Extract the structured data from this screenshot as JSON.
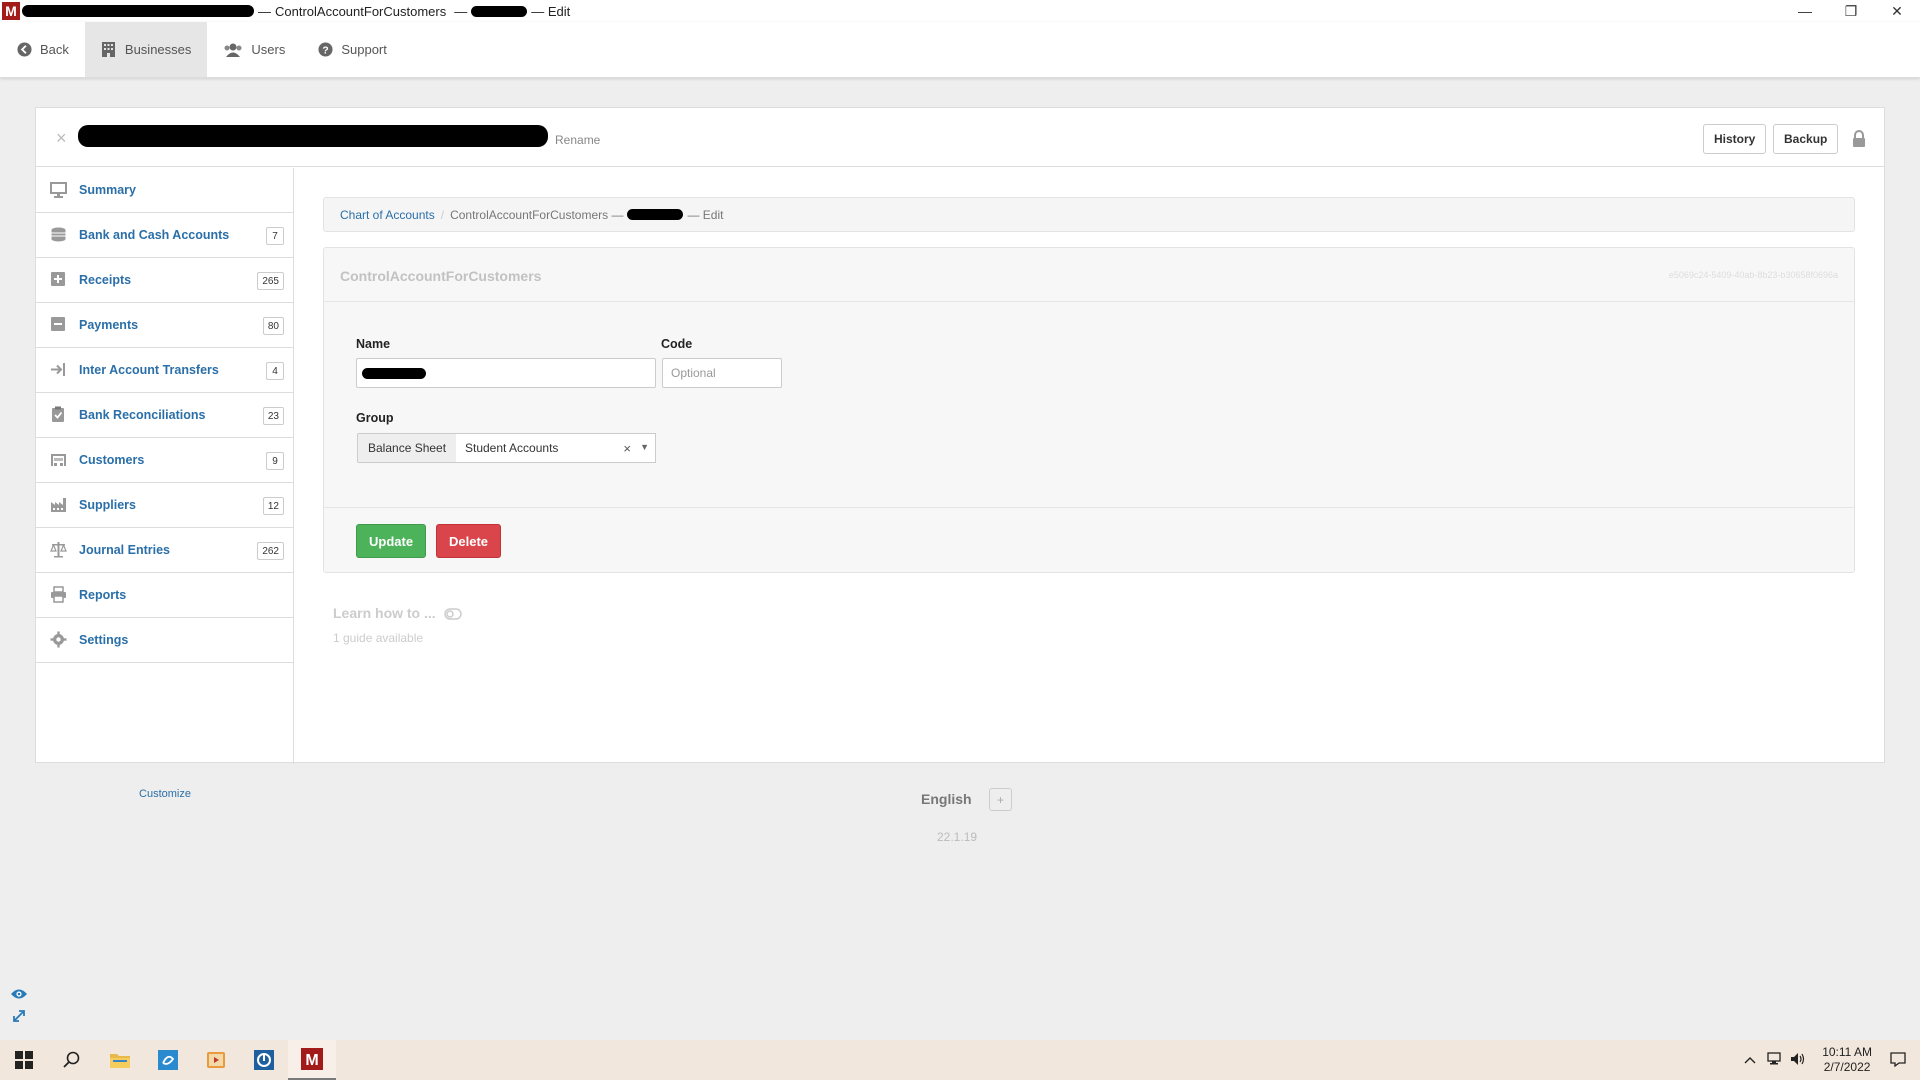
{
  "window": {
    "title_account": "ControlAccountForCustomers",
    "title_sep1": "—",
    "title_sep2": "—",
    "title_suffix": "— Edit"
  },
  "topnav": {
    "back": "Back",
    "businesses": "Businesses",
    "users": "Users",
    "support": "Support"
  },
  "header": {
    "rename": "Rename",
    "history": "History",
    "backup": "Backup"
  },
  "sidebar": {
    "items": [
      {
        "label": "Summary",
        "count": ""
      },
      {
        "label": "Bank and Cash Accounts",
        "count": "7"
      },
      {
        "label": "Receipts",
        "count": "265"
      },
      {
        "label": "Payments",
        "count": "80"
      },
      {
        "label": "Inter Account Transfers",
        "count": "4"
      },
      {
        "label": "Bank Reconciliations",
        "count": "23"
      },
      {
        "label": "Customers",
        "count": "9"
      },
      {
        "label": "Suppliers",
        "count": "12"
      },
      {
        "label": "Journal Entries",
        "count": "262"
      },
      {
        "label": "Reports",
        "count": ""
      },
      {
        "label": "Settings",
        "count": ""
      }
    ],
    "customize": "Customize"
  },
  "breadcrumb": {
    "root": "Chart of Accounts",
    "separator": "/",
    "current": "ControlAccountForCustomers —",
    "suffix": "— Edit"
  },
  "form": {
    "title": "ControlAccountForCustomers",
    "guid": "e5069c24-5409-40ab-8b23-b30658f0696a",
    "name_label": "Name",
    "code_label": "Code",
    "code_placeholder": "Optional",
    "group_label": "Group",
    "group_prefix": "Balance Sheet",
    "group_value": "Student Accounts",
    "clear": "×",
    "update": "Update",
    "delete": "Delete"
  },
  "guide": {
    "title": "Learn how to ...",
    "count": "1 guide available"
  },
  "footer": {
    "language": "English",
    "plus": "+",
    "version": "22.1.19"
  },
  "taskbar": {
    "time": "10:11 AM",
    "date": "2/7/2022"
  }
}
